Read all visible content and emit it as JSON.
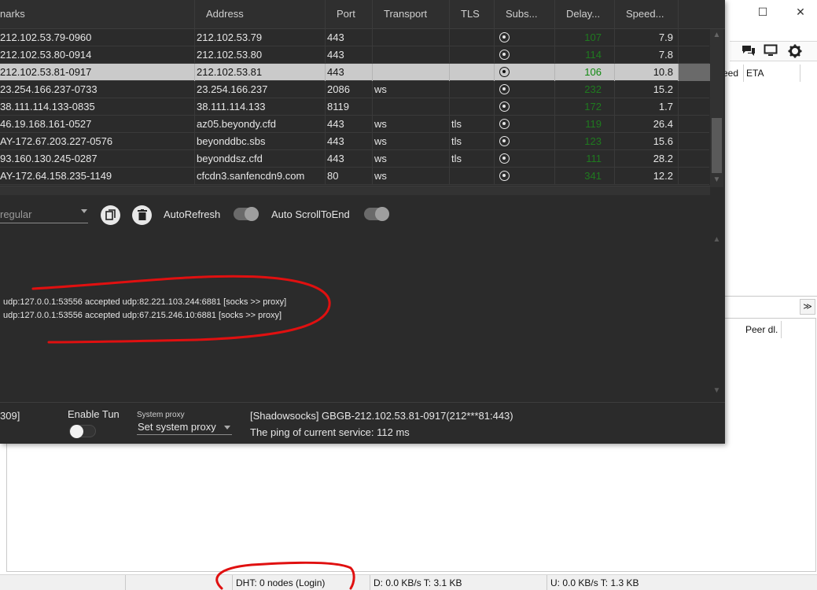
{
  "background_app": {
    "window_controls": {
      "maximize": "☐",
      "close": "✕"
    },
    "toolbar_icons": [
      "chat-icon",
      "monitor-icon",
      "gear-icon"
    ],
    "columns": [
      "eed",
      "ETA"
    ],
    "peer_column": "Peer dl.",
    "expander_glyph": "≫",
    "statusbar": {
      "dht": "DHT: 0 nodes (Login)",
      "download": "D: 0.0 KB/s T: 3.1 KB",
      "upload": "U: 0.0 KB/s T: 1.3 KB"
    }
  },
  "server_table": {
    "headers": [
      "narks",
      "Address",
      "Port",
      "Transport",
      "TLS",
      "Subs...",
      "Delay...",
      "Speed..."
    ],
    "rows": [
      {
        "remarks": "212.102.53.79-0960",
        "address": "212.102.53.79",
        "port": "443",
        "transport": "",
        "tls": "",
        "delay": "107",
        "speed": "7.9"
      },
      {
        "remarks": "212.102.53.80-0914",
        "address": "212.102.53.80",
        "port": "443",
        "transport": "",
        "tls": "",
        "delay": "114",
        "speed": "7.8"
      },
      {
        "remarks": "212.102.53.81-0917",
        "address": "212.102.53.81",
        "port": "443",
        "transport": "",
        "tls": "",
        "delay": "106",
        "speed": "10.8",
        "selected": true
      },
      {
        "remarks": "23.254.166.237-0733",
        "address": "23.254.166.237",
        "port": "2086",
        "transport": "ws",
        "tls": "",
        "delay": "232",
        "speed": "15.2"
      },
      {
        "remarks": "38.111.114.133-0835",
        "address": "38.111.114.133",
        "port": "8119",
        "transport": "",
        "tls": "",
        "delay": "172",
        "speed": "1.7"
      },
      {
        "remarks": "46.19.168.161-0527",
        "address": "az05.beyondy.cfd",
        "port": "443",
        "transport": "ws",
        "tls": "tls",
        "delay": "119",
        "speed": "26.4"
      },
      {
        "remarks": "AY-172.67.203.227-0576",
        "address": "beyonddbc.sbs",
        "port": "443",
        "transport": "ws",
        "tls": "tls",
        "delay": "123",
        "speed": "15.6"
      },
      {
        "remarks": "93.160.130.245-0287",
        "address": "beyonddsz.cfd",
        "port": "443",
        "transport": "ws",
        "tls": "tls",
        "delay": "111",
        "speed": "28.2"
      },
      {
        "remarks": "AY-172.64.158.235-1149",
        "address": "cfcdn3.sanfencdn9.com",
        "port": "80",
        "transport": "ws",
        "tls": "",
        "delay": "341",
        "speed": "12.2"
      }
    ]
  },
  "controls": {
    "filter_value": "regular",
    "auto_refresh_label": "AutoRefresh",
    "auto_scroll_label": "Auto ScrollToEnd"
  },
  "log": {
    "lines": [
      "udp:127.0.0.1:53556 accepted udp:82.221.103.244:6881 [socks >> proxy]",
      "udp:127.0.0.1:53556 accepted udp:67.215.246.10:6881 [socks >> proxy]"
    ]
  },
  "bottom": {
    "port_fragment": "309]",
    "enable_tun_label": "Enable Tun",
    "system_proxy_label": "System proxy",
    "system_proxy_value": "Set system proxy",
    "current_server": "[Shadowsocks] GBGB-212.102.53.81-0917(212***81:443)",
    "ping": "The ping of current service: 112 ms"
  },
  "colors": {
    "dark_bg": "#2b2b2b",
    "selected_row": "#cacaca",
    "delay_green": "#1f7a1f",
    "annotation_red": "#e01010"
  }
}
